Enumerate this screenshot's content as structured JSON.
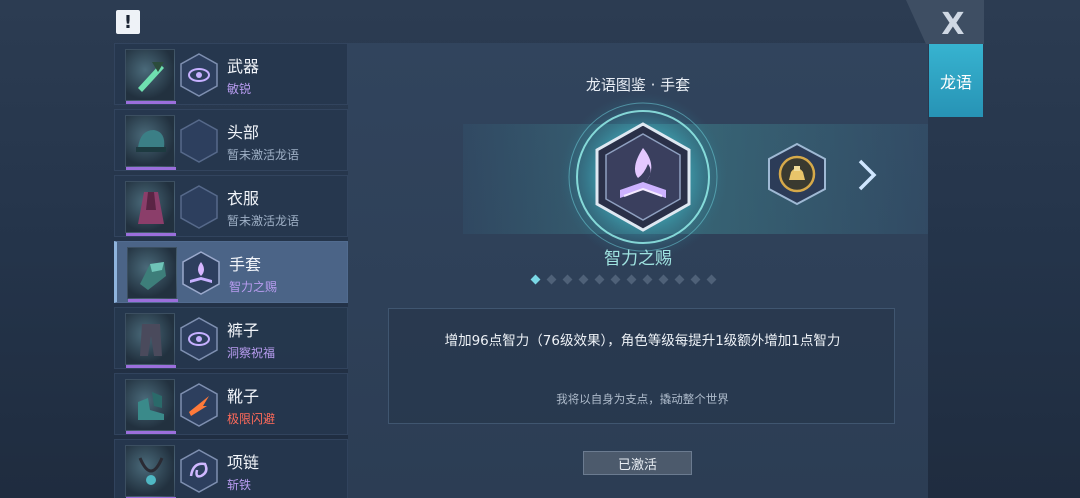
{
  "header": {
    "warning_icon": "!"
  },
  "close_icon": "X",
  "side_tab": {
    "label": "龙语"
  },
  "equipment": [
    {
      "name": "武器",
      "status": "敏锐",
      "status_color": "#b89cf0",
      "slot_icon": "eye-rune-icon"
    },
    {
      "name": "头部",
      "status": "暂未激活龙语",
      "status_color": "#9fb0c6",
      "slot_icon": "empty-slot-icon"
    },
    {
      "name": "衣服",
      "status": "暂未激活龙语",
      "status_color": "#9fb0c6",
      "slot_icon": "empty-slot-icon"
    },
    {
      "name": "手套",
      "status": "智力之赐",
      "status_color": "#b89cf0",
      "slot_icon": "flame-book-icon",
      "selected": true
    },
    {
      "name": "裤子",
      "status": "洞察祝福",
      "status_color": "#b89cf0",
      "slot_icon": "eye-rune-icon"
    },
    {
      "name": "靴子",
      "status": "极限闪避",
      "status_color": "#ff6a5a",
      "slot_icon": "dash-rune-icon"
    },
    {
      "name": "项链",
      "status": "斩铁",
      "status_color": "#b89cf0",
      "slot_icon": "swirl-rune-icon"
    }
  ],
  "codex": {
    "title": "龙语图鉴 · 手套",
    "skill_name": "智力之赐",
    "page_count": 12,
    "active_page": 1,
    "description": "增加96点智力（76级效果），角色等级每提升1级额外增加1点智力",
    "quote": "我将以自身为支点，撬动整个世界",
    "status_button": "已激活"
  },
  "colors": {
    "accent": "#37b3d0",
    "selected_row": "#4b6487",
    "highlight": "#9fe3e0"
  }
}
